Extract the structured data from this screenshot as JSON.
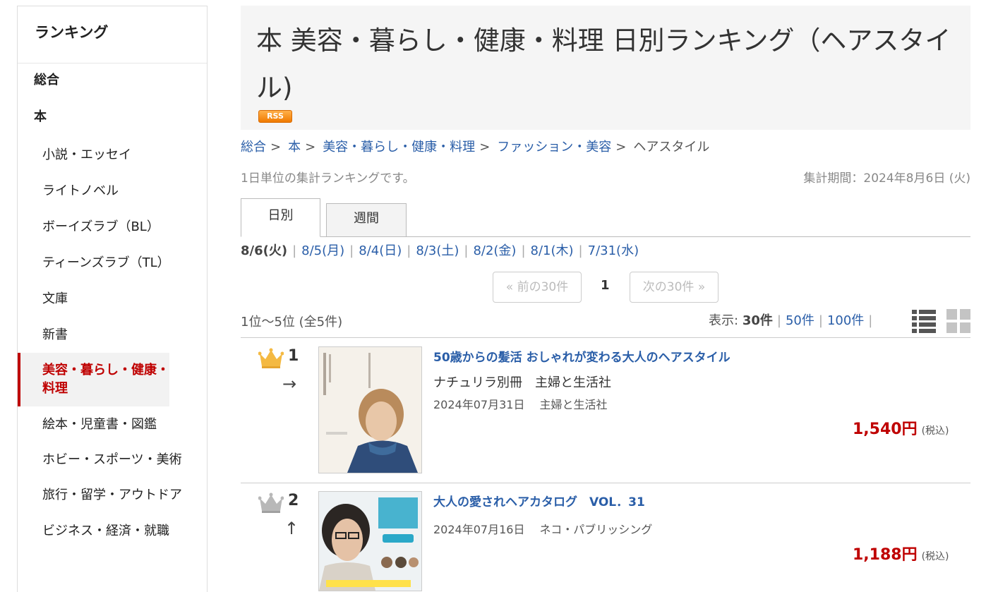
{
  "sidebar": {
    "title": "ランキング",
    "items": [
      {
        "label": "総合",
        "type": "top"
      },
      {
        "label": "本",
        "type": "top"
      },
      {
        "label": "小説・エッセイ",
        "type": "sub"
      },
      {
        "label": "ライトノベル",
        "type": "sub"
      },
      {
        "label": "ボーイズラブ（BL）",
        "type": "sub"
      },
      {
        "label": "ティーンズラブ（TL）",
        "type": "sub"
      },
      {
        "label": "文庫",
        "type": "sub"
      },
      {
        "label": "新書",
        "type": "sub"
      },
      {
        "label": "美容・暮らし・健康・料理",
        "type": "active"
      },
      {
        "label": "絵本・児童書・図鑑",
        "type": "sub"
      },
      {
        "label": "ホビー・スポーツ・美術",
        "type": "sub"
      },
      {
        "label": "旅行・留学・アウトドア",
        "type": "sub"
      },
      {
        "label": "ビジネス・経済・就職",
        "type": "sub"
      }
    ]
  },
  "header": {
    "title": "本  美容・暮らし・健康・料理  日別ランキング（ヘアスタイル)",
    "rss": "RSS"
  },
  "breadcrumb": {
    "items": [
      "総合",
      "本",
      "美容・暮らし・健康・料理",
      "ファッション・美容"
    ],
    "separator": ">",
    "current": "ヘアスタイル"
  },
  "description": "1日単位の集計ランキングです。",
  "period": "集計期間：2024年8月6日 (火)",
  "tabs": {
    "daily": "日別",
    "weekly": "週間"
  },
  "days": {
    "current": "8/6(火)",
    "links": [
      "8/5(月)",
      "8/4(日)",
      "8/3(土)",
      "8/2(金)",
      "8/1(木)",
      "7/31(水)"
    ],
    "separator": "|"
  },
  "pager": {
    "prev": "« 前の30件",
    "page": "1",
    "next": "次の30件 »"
  },
  "results": {
    "count": "1位～5位 (全5件)",
    "display_label": "表示:",
    "display_current": "30件",
    "display_options": [
      "50件",
      "100件"
    ],
    "separator": "|"
  },
  "items": [
    {
      "rank": "1",
      "arrow": "→",
      "crown": "gold",
      "title": "50歳からの髪活 おしゃれが変わる大人のヘアスタイル",
      "series": "ナチュリラ別冊　主婦と生活社",
      "meta": "2024年07月31日　 主婦と生活社",
      "price": "1,540円",
      "tax": "(税込)"
    },
    {
      "rank": "2",
      "arrow": "↑",
      "crown": "silver",
      "title": "大人の愛されヘアカタログ　VOL．31",
      "meta": "2024年07月16日　 ネコ・パブリッシング",
      "price": "1,188円",
      "tax": "(税込)"
    }
  ],
  "icons": {
    "crown_gold": "#f4b942",
    "crown_silver": "#b8b8b8",
    "list_view": "list-view-icon",
    "grid_view": "grid-view-icon"
  },
  "colors": {
    "accent": "#bf0000",
    "link": "#2a5ea8"
  }
}
